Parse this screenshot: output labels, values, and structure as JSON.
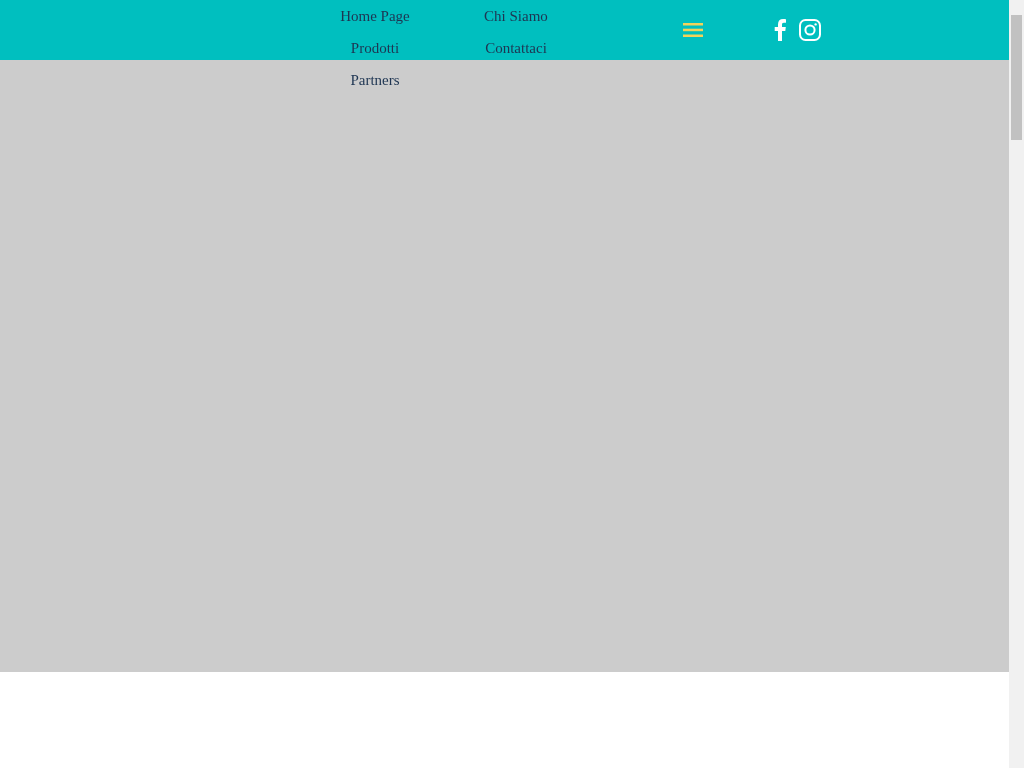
{
  "nav": {
    "items": [
      {
        "label": "Home Page"
      },
      {
        "label": "Chi Siamo"
      },
      {
        "label": "Prodotti"
      },
      {
        "label": "Contattaci"
      },
      {
        "label": "Partners"
      }
    ]
  }
}
